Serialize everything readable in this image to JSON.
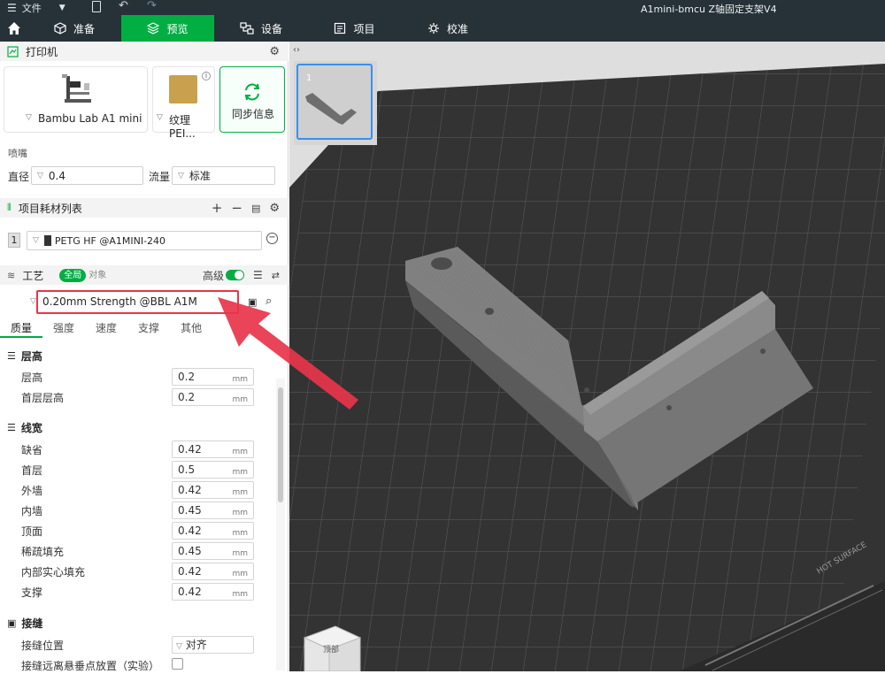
{
  "titlebar": {
    "menu_label": "文件",
    "title": "A1mini-bmcu Z轴固定支架V4"
  },
  "tabs": [
    {
      "label": "准备"
    },
    {
      "label": "预览"
    },
    {
      "label": "设备"
    },
    {
      "label": "项目"
    },
    {
      "label": "校准"
    }
  ],
  "printer": {
    "header": "打印机",
    "model": "Bambu Lab A1 mini",
    "plate": "纹理PEI...",
    "sync_label": "同步信息",
    "nozzle_header": "喷嘴",
    "diameter_label": "直径",
    "diameter_value": "0.4",
    "flow_label": "流量",
    "flow_value": "标准"
  },
  "filament": {
    "header": "项目耗材列表",
    "slot": "1",
    "name": "PETG HF @A1MINI-240"
  },
  "process": {
    "header": "工艺",
    "scope_global": "全局",
    "scope_object": "对象",
    "advanced_label": "高级",
    "preset": "0.20mm Strength @BBL A1M",
    "subtabs": [
      "质量",
      "强度",
      "速度",
      "支撑",
      "其他"
    ],
    "layer_height": {
      "group": "层高",
      "rows": [
        {
          "label": "层高",
          "value": "0.2",
          "unit": "mm"
        },
        {
          "label": "首层层高",
          "value": "0.2",
          "unit": "mm"
        }
      ]
    },
    "line_width": {
      "group": "线宽",
      "rows": [
        {
          "label": "缺省",
          "value": "0.42",
          "unit": "mm"
        },
        {
          "label": "首层",
          "value": "0.5",
          "unit": "mm"
        },
        {
          "label": "外墙",
          "value": "0.42",
          "unit": "mm"
        },
        {
          "label": "内墙",
          "value": "0.45",
          "unit": "mm"
        },
        {
          "label": "顶面",
          "value": "0.42",
          "unit": "mm"
        },
        {
          "label": "稀疏填充",
          "value": "0.45",
          "unit": "mm"
        },
        {
          "label": "内部实心填充",
          "value": "0.42",
          "unit": "mm"
        },
        {
          "label": "支撑",
          "value": "0.42",
          "unit": "mm"
        }
      ]
    },
    "seam": {
      "group": "接缝",
      "position_label": "接缝位置",
      "position_value": "对齐",
      "staggered_label": "接缝远离悬垂点放置（实验）"
    }
  },
  "viewport": {
    "plate_number": "1",
    "bed_text": "HOT SURFACE",
    "cube_label": "顶部"
  },
  "colors": {
    "accent": "#00ae42",
    "topbar": "#263238",
    "highlight": "#e8344a"
  }
}
